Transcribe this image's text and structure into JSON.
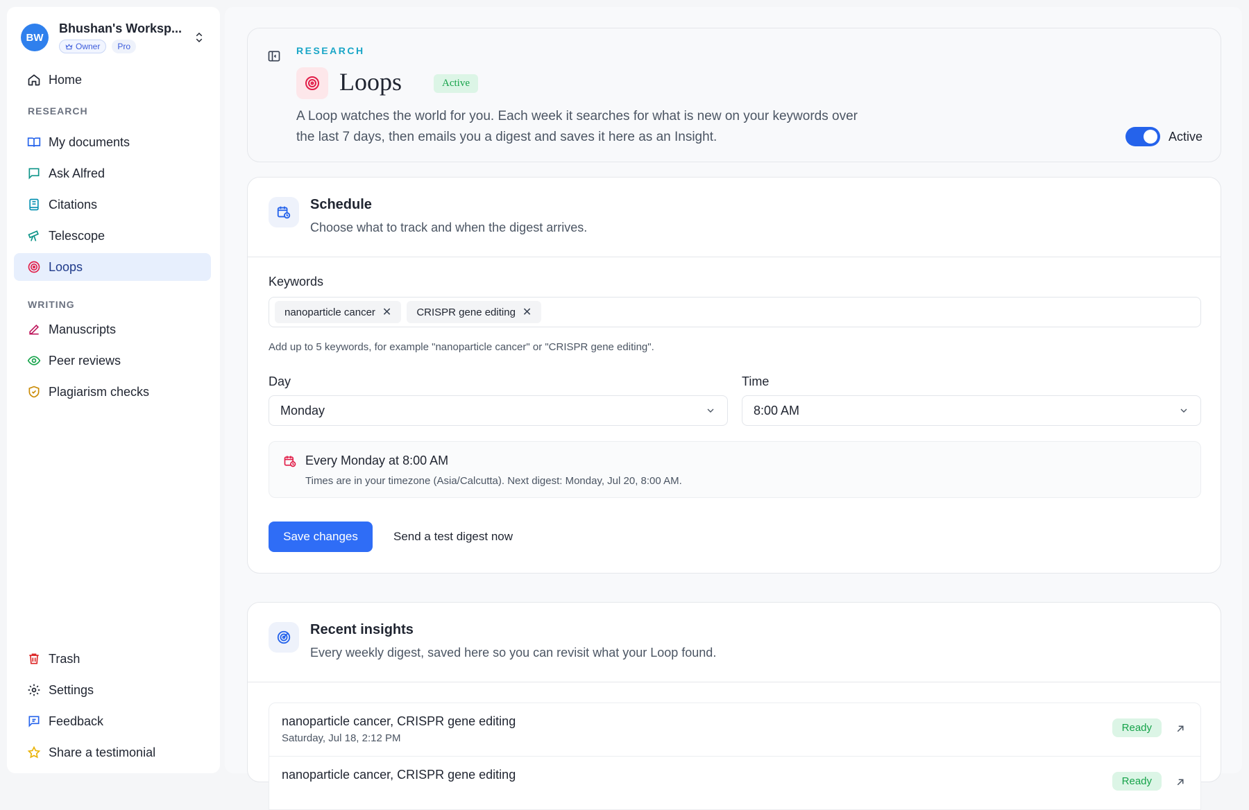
{
  "workspace": {
    "avatar": "BW",
    "name": "Bhushan's Worksp...",
    "role": "Owner",
    "plan": "Pro"
  },
  "nav": {
    "home": "Home",
    "research_label": "RESEARCH",
    "research": [
      "My documents",
      "Ask Alfred",
      "Citations",
      "Telescope",
      "Loops"
    ],
    "writing_label": "WRITING",
    "writing": [
      "Manuscripts",
      "Peer reviews",
      "Plagiarism checks"
    ],
    "bottom": [
      "Trash",
      "Settings",
      "Feedback",
      "Share a testimonial"
    ]
  },
  "hero": {
    "eyebrow": "RESEARCH",
    "title": "Loops",
    "status": "Active",
    "description": "A Loop watches the world for you. Each week it searches for what is new on your keywords over the last 7 days, then emails you a digest and saves it here as an Insight.",
    "toggle_label": "Active",
    "toggle_on": true
  },
  "schedule": {
    "title": "Schedule",
    "subtitle": "Choose what to track and when the digest arrives.",
    "keywords_label": "Keywords",
    "keywords": [
      "nanoparticle cancer",
      "CRISPR gene editing"
    ],
    "keywords_hint": "Add up to 5 keywords, for example \"nanoparticle cancer\" or \"CRISPR gene editing\".",
    "day_label": "Day",
    "day_value": "Monday",
    "time_label": "Time",
    "time_value": "8:00 AM",
    "summary_title": "Every Monday at 8:00 AM",
    "summary_sub": "Times are in your timezone (Asia/Calcutta). Next digest: Monday, Jul 20, 8:00 AM.",
    "save_label": "Save changes",
    "test_label": "Send a test digest now"
  },
  "insights": {
    "title": "Recent insights",
    "subtitle": "Every weekly digest, saved here so you can revisit what your Loop found.",
    "items": [
      {
        "title": "nanoparticle cancer, CRISPR gene editing",
        "date": "Saturday, Jul 18, 2:12 PM",
        "status": "Ready"
      },
      {
        "title": "nanoparticle cancer, CRISPR gene editing",
        "date": "",
        "status": "Ready"
      }
    ]
  },
  "colors": {
    "accent": "#2f6df6",
    "success": "#16a34a",
    "eyebrow": "#1aa6c7",
    "loops": "#e11d48"
  }
}
